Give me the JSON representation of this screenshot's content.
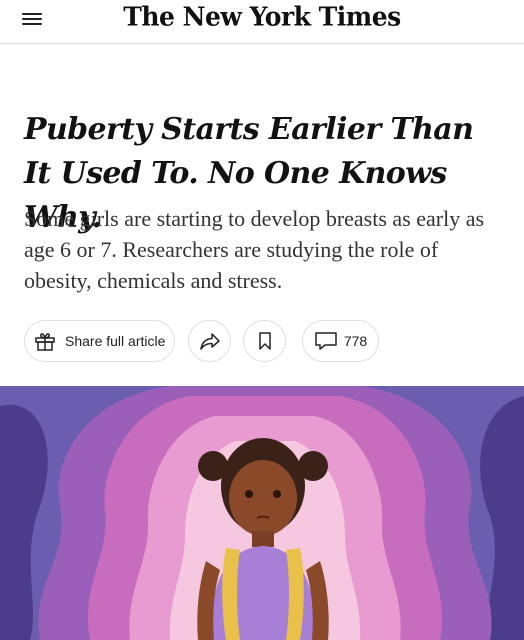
{
  "header": {
    "masthead": "The New York Times",
    "menu_icon": "hamburger-menu-icon"
  },
  "article": {
    "headline": "Puberty Starts Earlier Than It Used To. No One Knows Why.",
    "summary": "Some girls are starting to develop breasts as early as age 6 or 7. Researchers are studying the role of obesity, chemicals and stress."
  },
  "actions": {
    "share_label": "Share full article",
    "share_icon": "gift-icon",
    "forward_icon": "share-arrow-icon",
    "bookmark_icon": "bookmark-icon",
    "comments_icon": "comment-bubble-icon",
    "comments_count": "778"
  },
  "illustration": {
    "subject": "illustration of a girl with layered pink and purple silhouettes",
    "colors": {
      "outer": "#6b5db0",
      "ring1": "#9a5fb8",
      "ring2": "#c86cbd",
      "ring3": "#e79bd0",
      "ring4": "#f6c8e0",
      "skin": "#8a4a2a",
      "shirt": "#a77fd6"
    }
  }
}
